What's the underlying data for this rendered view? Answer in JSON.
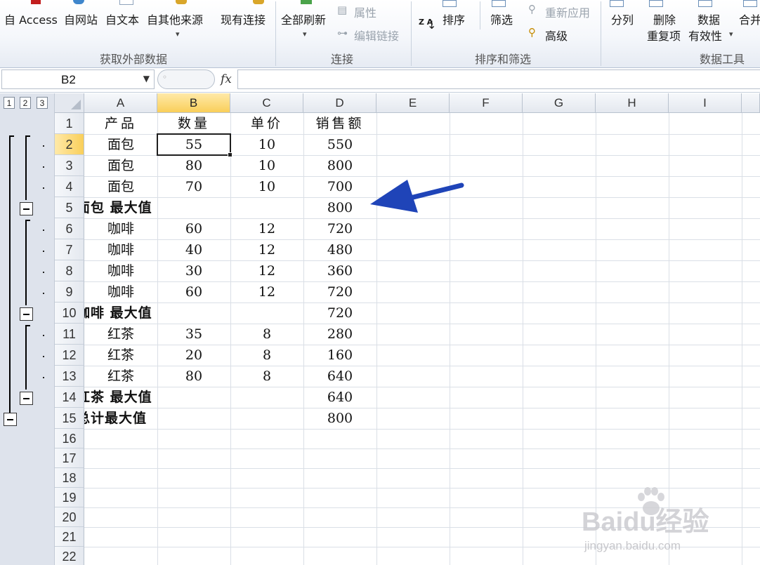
{
  "ribbon": {
    "groups": [
      {
        "name": "ext-data",
        "label": "获取外部数据"
      },
      {
        "name": "connections",
        "label": "连接"
      },
      {
        "name": "sort-filter",
        "label": "排序和筛选"
      },
      {
        "name": "data-tools",
        "label": "数据工具"
      }
    ],
    "buttons": {
      "from_access": "自 Access",
      "from_web": "自网站",
      "from_text": "自文本",
      "from_other": "自其他来源",
      "existing_connections": "现有连接",
      "refresh_all": "全部刷新",
      "properties": "属性",
      "edit_links": "编辑链接",
      "sort": "排序",
      "filter": "筛选",
      "reapply": "重新应用",
      "advanced": "高级",
      "text_to_columns": "分列",
      "remove_dup_1": "删除",
      "remove_dup_2": "重复项",
      "validation_1": "数据",
      "validation_2": "有效性",
      "consolidate": "合并",
      "sort_az_icon": "Z A"
    }
  },
  "formula_bar": {
    "name_box": "B2",
    "fx": "fx",
    "content": ""
  },
  "outline": {
    "levels": [
      "1",
      "2",
      "3"
    ]
  },
  "columns": [
    "A",
    "B",
    "C",
    "D",
    "E",
    "F",
    "G",
    "H",
    "I"
  ],
  "selected_column": "B",
  "selected_row": "2",
  "row_numbers": [
    "1",
    "2",
    "3",
    "4",
    "5",
    "6",
    "7",
    "8",
    "9",
    "10",
    "11",
    "12",
    "13",
    "14",
    "15",
    "16",
    "17",
    "18",
    "19",
    "20",
    "21",
    "22"
  ],
  "sheet": {
    "header": {
      "a": "产品",
      "b": "数量",
      "c": "单价",
      "d": "销售额"
    },
    "rows": [
      {
        "a": "面包",
        "b": "55",
        "c": "10",
        "d": "550"
      },
      {
        "a": "面包",
        "b": "80",
        "c": "10",
        "d": "800"
      },
      {
        "a": "面包",
        "b": "70",
        "c": "10",
        "d": "700"
      },
      {
        "label": "面包 最大值",
        "d": "800"
      },
      {
        "a": "咖啡",
        "b": "60",
        "c": "12",
        "d": "720"
      },
      {
        "a": "咖啡",
        "b": "40",
        "c": "12",
        "d": "480"
      },
      {
        "a": "咖啡",
        "b": "30",
        "c": "12",
        "d": "360"
      },
      {
        "a": "咖啡",
        "b": "60",
        "c": "12",
        "d": "720"
      },
      {
        "label": "咖啡 最大值",
        "d": "720"
      },
      {
        "a": "红茶",
        "b": "35",
        "c": "8",
        "d": "280"
      },
      {
        "a": "红茶",
        "b": "20",
        "c": "8",
        "d": "160"
      },
      {
        "a": "红茶",
        "b": "80",
        "c": "8",
        "d": "640"
      },
      {
        "label": "红茶 最大值",
        "d": "640"
      },
      {
        "label": "总计最大值",
        "d": "800"
      }
    ]
  },
  "annotation": {
    "color": "#1f44b8"
  },
  "watermark": {
    "brand": "Baidu经验",
    "url": "jingyan.baidu.com"
  }
}
